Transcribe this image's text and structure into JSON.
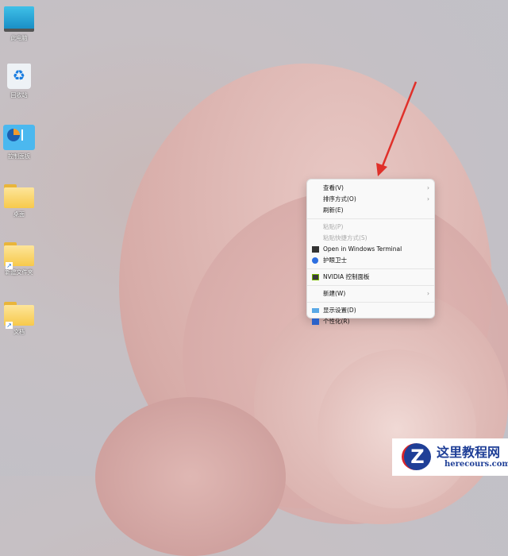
{
  "desktop_icons": [
    {
      "label": "此电脑",
      "icon": "computer-icon"
    },
    {
      "label": "回收站",
      "icon": "recycle-bin-icon"
    },
    {
      "label": "控制面板",
      "icon": "control-panel-icon"
    },
    {
      "label": "桌面",
      "icon": "folder-icon"
    },
    {
      "label": "新建文件夹",
      "icon": "folder-shortcut-icon"
    },
    {
      "label": "文档",
      "icon": "folder-shortcut-icon"
    }
  ],
  "context_menu": {
    "view": "查看(V)",
    "sort": "排序方式(O)",
    "refresh": "刷新(E)",
    "paste": "粘贴(P)",
    "paste_shortcut": "粘贴快捷方式(S)",
    "terminal": "Open in Windows Terminal",
    "eye": "护眼卫士",
    "nvidia": "NVIDIA 控制面板",
    "new": "新建(W)",
    "display": "显示设置(D)",
    "personalize": "个性化(R)"
  },
  "watermark": {
    "title": "这里教程网",
    "url": "herecours.com"
  },
  "colors": {
    "accent_arrow": "#e0302a"
  }
}
